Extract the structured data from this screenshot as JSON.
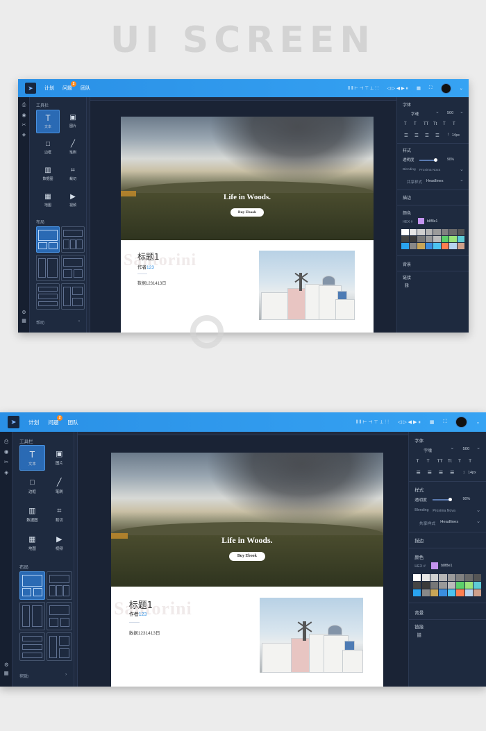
{
  "banner": "UI SCREEN",
  "app": {
    "nav": [
      "计划",
      "问题",
      "团队"
    ],
    "nav_badge": "2",
    "left_panel": {
      "tools_title": "工具栏",
      "tools": [
        {
          "glyph": "T",
          "label": "文本",
          "icon": "text-icon"
        },
        {
          "glyph": "▣",
          "label": "图片",
          "icon": "image-icon"
        },
        {
          "glyph": "□",
          "label": "边框",
          "icon": "border-icon"
        },
        {
          "glyph": "╱",
          "label": "笔刷",
          "icon": "brush-icon"
        },
        {
          "glyph": "▥",
          "label": "数据图",
          "icon": "chart-icon"
        },
        {
          "glyph": "⌗",
          "label": "裁切",
          "icon": "crop-icon"
        },
        {
          "glyph": "▦",
          "label": "地图",
          "icon": "map-icon"
        },
        {
          "glyph": "▶",
          "label": "视频",
          "icon": "video-icon"
        }
      ],
      "layout_title": "布局",
      "help": "帮助",
      "help_arrow": "›"
    },
    "canvas": {
      "hero_title": "Life in Woods.",
      "hero_button": "Buy Ebook",
      "ghost_text": "Santorini",
      "card_title": "标题1",
      "author_label": "作者",
      "author_num": "123",
      "card_meta": "数据1231413日"
    },
    "right_panel": {
      "font_section": "字体",
      "font_family": "字魂",
      "font_size": "500",
      "text_styles": [
        "T",
        "T",
        "TT",
        "Tt",
        "T",
        "T"
      ],
      "line_height": "14px",
      "style_section": "样式",
      "opacity_label": "透明度",
      "opacity_value": "90%",
      "opacity": 0.9,
      "blending_label": "Blending",
      "blending_value": "Proxima Nova",
      "shared_style_label": "共享样式",
      "shared_style_value": "Headlines",
      "stroke_section": "描边",
      "color_section": "颜色",
      "hex_label": "HEX #",
      "hex_value": "b8f8e1",
      "background_section": "背景",
      "link_section": "链接",
      "palette": [
        "#ffffff",
        "#e6e6e6",
        "#cfcfcf",
        "#b5b5b5",
        "#9b9b9b",
        "#818181",
        "#6a6a6a",
        "#555555",
        "#444444",
        "#3a3a3a",
        "#777777",
        "#999999",
        "#bbbbbb",
        "#5cd06a",
        "#9be37a",
        "#5ecbd6",
        "#29a3f0",
        "#888888",
        "#c8a557",
        "#3a8ee0",
        "#4cc3f0",
        "#ff7f50",
        "#b7d4f0",
        "#cfa08a"
      ]
    }
  }
}
